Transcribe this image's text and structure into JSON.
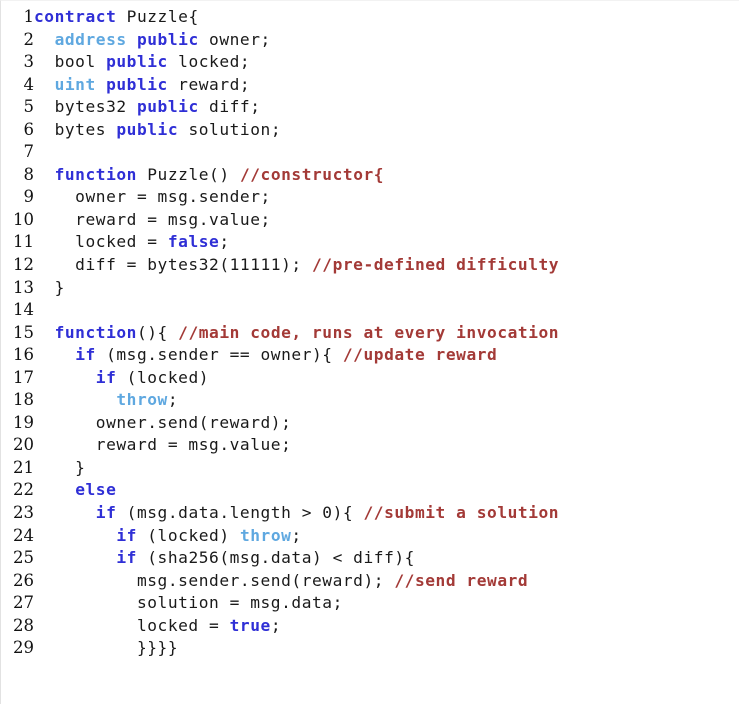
{
  "listing": {
    "language": "Solidity",
    "title": "contract Puzzle",
    "first_line_number": 1,
    "last_line_number": 29,
    "background_color": "#ffffff",
    "colors": {
      "plain": "#1a1a1a",
      "keyword": "#2f2fd6",
      "type": "#5fa8e0",
      "comment": "#a33a37",
      "line_number": "#111111",
      "background": "#ffffff"
    },
    "lines": [
      {
        "number": "1",
        "tokens": [
          {
            "text": "contract ",
            "kind": "keyword"
          },
          {
            "text": "Puzzle{",
            "kind": "plain"
          }
        ]
      },
      {
        "number": "2",
        "tokens": [
          {
            "text": "  ",
            "kind": "plain"
          },
          {
            "text": "address",
            "kind": "type"
          },
          {
            "text": " ",
            "kind": "plain"
          },
          {
            "text": "public",
            "kind": "keyword"
          },
          {
            "text": " owner;",
            "kind": "plain"
          }
        ]
      },
      {
        "number": "3",
        "tokens": [
          {
            "text": "  bool ",
            "kind": "plain"
          },
          {
            "text": "public",
            "kind": "keyword"
          },
          {
            "text": " locked;",
            "kind": "plain"
          }
        ]
      },
      {
        "number": "4",
        "tokens": [
          {
            "text": "  ",
            "kind": "plain"
          },
          {
            "text": "uint",
            "kind": "type"
          },
          {
            "text": " ",
            "kind": "plain"
          },
          {
            "text": "public",
            "kind": "keyword"
          },
          {
            "text": " reward;",
            "kind": "plain"
          }
        ]
      },
      {
        "number": "5",
        "tokens": [
          {
            "text": "  bytes32 ",
            "kind": "plain"
          },
          {
            "text": "public",
            "kind": "keyword"
          },
          {
            "text": " diff;",
            "kind": "plain"
          }
        ]
      },
      {
        "number": "6",
        "tokens": [
          {
            "text": "  bytes ",
            "kind": "plain"
          },
          {
            "text": "public",
            "kind": "keyword"
          },
          {
            "text": " solution;",
            "kind": "plain"
          }
        ]
      },
      {
        "number": "7",
        "tokens": []
      },
      {
        "number": "8",
        "tokens": [
          {
            "text": "  ",
            "kind": "plain"
          },
          {
            "text": "function",
            "kind": "keyword"
          },
          {
            "text": " Puzzle() ",
            "kind": "plain"
          },
          {
            "text": "//constructor{",
            "kind": "comment"
          }
        ]
      },
      {
        "number": "9",
        "tokens": [
          {
            "text": "    owner = msg.sender;",
            "kind": "plain"
          }
        ]
      },
      {
        "number": "10",
        "tokens": [
          {
            "text": "    reward = msg.value;",
            "kind": "plain"
          }
        ]
      },
      {
        "number": "11",
        "tokens": [
          {
            "text": "    locked = ",
            "kind": "plain"
          },
          {
            "text": "false",
            "kind": "keyword"
          },
          {
            "text": ";",
            "kind": "plain"
          }
        ]
      },
      {
        "number": "12",
        "tokens": [
          {
            "text": "    diff = bytes32(11111); ",
            "kind": "plain"
          },
          {
            "text": "//pre-defined difficulty",
            "kind": "comment"
          }
        ]
      },
      {
        "number": "13",
        "tokens": [
          {
            "text": "  }",
            "kind": "plain"
          }
        ]
      },
      {
        "number": "14",
        "tokens": []
      },
      {
        "number": "15",
        "tokens": [
          {
            "text": "  ",
            "kind": "plain"
          },
          {
            "text": "function",
            "kind": "keyword"
          },
          {
            "text": "(){ ",
            "kind": "plain"
          },
          {
            "text": "//main code, runs at every invocation",
            "kind": "comment"
          }
        ]
      },
      {
        "number": "16",
        "tokens": [
          {
            "text": "    ",
            "kind": "plain"
          },
          {
            "text": "if",
            "kind": "keyword"
          },
          {
            "text": " (msg.sender == owner){ ",
            "kind": "plain"
          },
          {
            "text": "//update reward",
            "kind": "comment"
          }
        ]
      },
      {
        "number": "17",
        "tokens": [
          {
            "text": "      ",
            "kind": "plain"
          },
          {
            "text": "if",
            "kind": "keyword"
          },
          {
            "text": " (locked)",
            "kind": "plain"
          }
        ]
      },
      {
        "number": "18",
        "tokens": [
          {
            "text": "        ",
            "kind": "plain"
          },
          {
            "text": "throw",
            "kind": "type"
          },
          {
            "text": ";",
            "kind": "plain"
          }
        ]
      },
      {
        "number": "19",
        "tokens": [
          {
            "text": "      owner.send(reward);",
            "kind": "plain"
          }
        ]
      },
      {
        "number": "20",
        "tokens": [
          {
            "text": "      reward = msg.value;",
            "kind": "plain"
          }
        ]
      },
      {
        "number": "21",
        "tokens": [
          {
            "text": "    }",
            "kind": "plain"
          }
        ]
      },
      {
        "number": "22",
        "tokens": [
          {
            "text": "    ",
            "kind": "plain"
          },
          {
            "text": "else",
            "kind": "keyword"
          }
        ]
      },
      {
        "number": "23",
        "tokens": [
          {
            "text": "      ",
            "kind": "plain"
          },
          {
            "text": "if",
            "kind": "keyword"
          },
          {
            "text": " (msg.data.length > 0){ ",
            "kind": "plain"
          },
          {
            "text": "//submit a solution",
            "kind": "comment"
          }
        ]
      },
      {
        "number": "24",
        "tokens": [
          {
            "text": "        ",
            "kind": "plain"
          },
          {
            "text": "if",
            "kind": "keyword"
          },
          {
            "text": " (locked) ",
            "kind": "plain"
          },
          {
            "text": "throw",
            "kind": "type"
          },
          {
            "text": ";",
            "kind": "plain"
          }
        ]
      },
      {
        "number": "25",
        "tokens": [
          {
            "text": "        ",
            "kind": "plain"
          },
          {
            "text": "if",
            "kind": "keyword"
          },
          {
            "text": " (sha256(msg.data) < diff){",
            "kind": "plain"
          }
        ]
      },
      {
        "number": "26",
        "tokens": [
          {
            "text": "          msg.sender.send(reward); ",
            "kind": "plain"
          },
          {
            "text": "//send reward",
            "kind": "comment"
          }
        ]
      },
      {
        "number": "27",
        "tokens": [
          {
            "text": "          solution = msg.data;",
            "kind": "plain"
          }
        ]
      },
      {
        "number": "28",
        "tokens": [
          {
            "text": "          locked = ",
            "kind": "plain"
          },
          {
            "text": "true",
            "kind": "keyword"
          },
          {
            "text": ";",
            "kind": "plain"
          }
        ]
      },
      {
        "number": "29",
        "tokens": [
          {
            "text": "          }}}}",
            "kind": "plain"
          }
        ]
      }
    ]
  }
}
